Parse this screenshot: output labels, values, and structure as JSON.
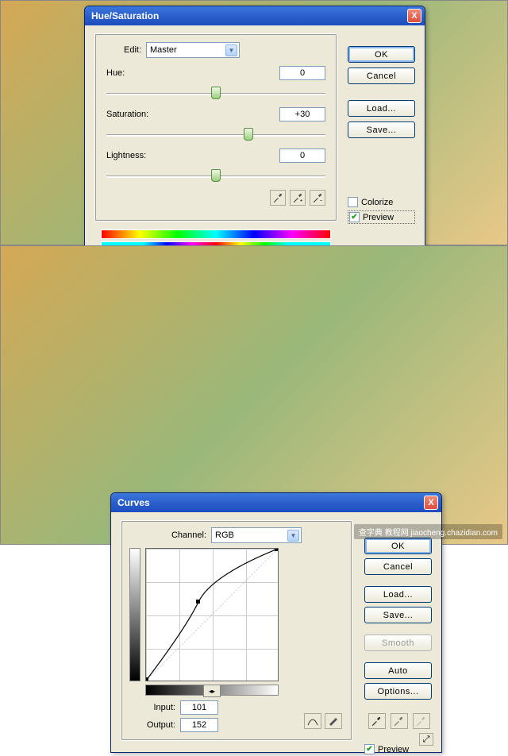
{
  "hs": {
    "title": "Hue/Saturation",
    "close": "X",
    "edit_label": "Edit:",
    "edit_value": "Master",
    "hue": {
      "label": "Hue:",
      "value": "0",
      "pos_pct": 50
    },
    "sat": {
      "label": "Saturation:",
      "value": "+30",
      "pos_pct": 65
    },
    "lig": {
      "label": "Lightness:",
      "value": "0",
      "pos_pct": 50
    },
    "colorize": "Colorize",
    "preview": "Preview",
    "buttons": {
      "ok": "OK",
      "cancel": "Cancel",
      "load": "Load...",
      "save": "Save..."
    }
  },
  "cv": {
    "title": "Curves",
    "close": "X",
    "channel_label": "Channel:",
    "channel_value": "RGB",
    "input_label": "Input:",
    "input_value": "101",
    "output_label": "Output:",
    "output_value": "152",
    "preview": "Preview",
    "buttons": {
      "ok": "OK",
      "cancel": "Cancel",
      "load": "Load...",
      "save": "Save...",
      "smooth": "Smooth",
      "auto": "Auto",
      "options": "Options..."
    }
  },
  "watermark": "查字典 教程网  jiaocheng.chazidian.com",
  "chart_data": {
    "type": "line",
    "title": "Curves",
    "xlabel": "Input",
    "ylabel": "Output",
    "xlim": [
      0,
      255
    ],
    "ylim": [
      0,
      255
    ],
    "points": [
      {
        "x": 0,
        "y": 0
      },
      {
        "x": 101,
        "y": 152
      },
      {
        "x": 255,
        "y": 255
      }
    ]
  }
}
